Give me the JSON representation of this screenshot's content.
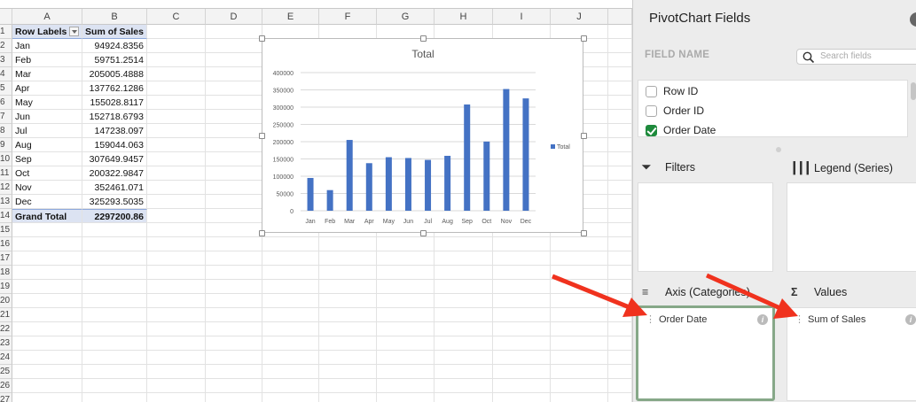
{
  "sheet": {
    "columns": [
      "A",
      "B",
      "C",
      "D",
      "E",
      "F",
      "G",
      "H",
      "I",
      "J"
    ],
    "row_numbers": [
      "1",
      "2",
      "3",
      "4",
      "5",
      "6",
      "7",
      "8",
      "9",
      "10",
      "11",
      "12",
      "13",
      "14",
      "15",
      "16",
      "17",
      "18",
      "19",
      "20",
      "21",
      "22",
      "23",
      "24",
      "25",
      "26",
      "27"
    ],
    "pivot": {
      "header": {
        "label": "Row Labels",
        "value": "Sum of Sales"
      },
      "rows": [
        {
          "label": "Jan",
          "value": "94924.8356"
        },
        {
          "label": "Feb",
          "value": "59751.2514"
        },
        {
          "label": "Mar",
          "value": "205005.4888"
        },
        {
          "label": "Apr",
          "value": "137762.1286"
        },
        {
          "label": "May",
          "value": "155028.8117"
        },
        {
          "label": "Jun",
          "value": "152718.6793"
        },
        {
          "label": "Jul",
          "value": "147238.097"
        },
        {
          "label": "Aug",
          "value": "159044.063"
        },
        {
          "label": "Sep",
          "value": "307649.9457"
        },
        {
          "label": "Oct",
          "value": "200322.9847"
        },
        {
          "label": "Nov",
          "value": "352461.071"
        },
        {
          "label": "Dec",
          "value": "325293.5035"
        }
      ],
      "total": {
        "label": "Grand Total",
        "value": "2297200.86"
      }
    }
  },
  "chart_data": {
    "type": "bar",
    "title": "Total",
    "categories": [
      "Jan",
      "Feb",
      "Mar",
      "Apr",
      "May",
      "Jun",
      "Jul",
      "Aug",
      "Sep",
      "Oct",
      "Nov",
      "Dec"
    ],
    "series": [
      {
        "name": "Total",
        "values": [
          94924.8356,
          59751.2514,
          205005.4888,
          137762.1286,
          155028.8117,
          152718.6793,
          147238.097,
          159044.063,
          307649.9457,
          200322.9847,
          352461.071,
          325293.5035
        ]
      }
    ],
    "ylim": [
      0,
      400000
    ],
    "yticks": [
      "0",
      "50000",
      "100000",
      "150000",
      "200000",
      "250000",
      "300000",
      "350000",
      "400000"
    ],
    "grid": true,
    "legend": "right",
    "color": "#4472c4"
  },
  "panel": {
    "title": "PivotChart Fields",
    "field_name_label": "FIELD NAME",
    "search_placeholder": "Search fields",
    "fields": [
      {
        "label": "Row ID",
        "checked": false
      },
      {
        "label": "Order ID",
        "checked": false
      },
      {
        "label": "Order Date",
        "checked": true
      }
    ],
    "areas": {
      "filters": "Filters",
      "legend": "Legend (Series)",
      "axis": "Axis (Categories)",
      "values": "Values"
    },
    "axis_items": [
      "Order Date"
    ],
    "values_items": [
      "Sum of Sales"
    ]
  },
  "annotation_color": "#f0321e"
}
